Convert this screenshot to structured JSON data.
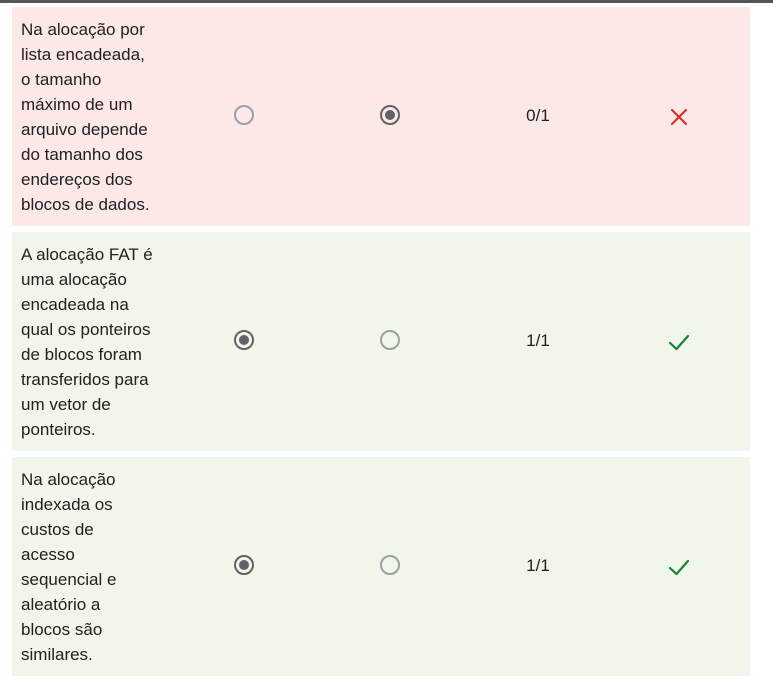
{
  "colors": {
    "incorrect_bg": "#fce8e6",
    "correct_bg": "#f0f6e9",
    "cross": "#d93025",
    "check": "#188038",
    "radio_checked": "#5f6368",
    "radio_unchecked": "#9aa0a6"
  },
  "rows": [
    {
      "statement": "Na alocação por\nlista encadeada,\no tamanho\nmáximo de um\narquivo depende\ndo tamanho dos\nendereços dos\nblocos de dados.",
      "selected_option": 2,
      "score": "0/1",
      "result": "incorrect",
      "result_icon": "cross-icon"
    },
    {
      "statement": "A alocação FAT é\numa alocação\nencadeada na\nqual os ponteiros\nde blocos foram\ntransferidos para\num vetor de\nponteiros.",
      "selected_option": 1,
      "score": "1/1",
      "result": "correct",
      "result_icon": "check-icon"
    },
    {
      "statement": "Na alocação\nindexada os\ncustos de\nacesso\nsequencial e\naleatório a\nblocos são\nsimilares.",
      "selected_option": 1,
      "score": "1/1",
      "result": "correct",
      "result_icon": "check-icon"
    }
  ]
}
